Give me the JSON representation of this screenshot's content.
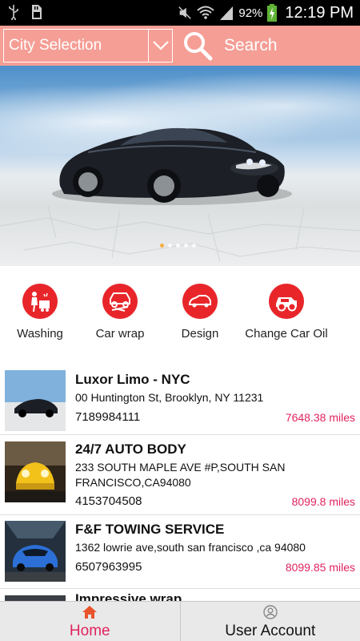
{
  "status_bar": {
    "battery": "92%",
    "time": "12:19 PM",
    "icons": [
      "usb-icon",
      "sd-card-icon",
      "mute-icon",
      "wifi-icon",
      "signal-icon",
      "battery-charging-icon"
    ]
  },
  "header": {
    "city_selection": "City Selection",
    "search_label": "Search"
  },
  "banner": {
    "image": "black sports car on salt flat",
    "slide_count": 5,
    "active_slide": 1
  },
  "categories": [
    {
      "label": "Washing",
      "icon": "washing-icon"
    },
    {
      "label": "Car wrap",
      "icon": "car-wrap-icon"
    },
    {
      "label": "Design",
      "icon": "design-icon"
    },
    {
      "label": "Change Car  Oil",
      "icon": "change-oil-icon"
    }
  ],
  "listings": [
    {
      "name": "Luxor Limo - NYC",
      "address": "00 Huntington St, Brooklyn, NY 11231",
      "phone": "7189984111",
      "distance": "7648.38 miles"
    },
    {
      "name": "24/7 AUTO BODY",
      "address": "233 SOUTH MAPLE AVE #P,SOUTH SAN FRANCISCO,CA94080",
      "phone": "4153704508",
      "distance": "8099.8 miles"
    },
    {
      "name": "F&F TOWING SERVICE",
      "address": "1362 lowrie ave,south san francisco ,ca 94080",
      "phone": "6507963995",
      "distance": "8099.85 miles"
    },
    {
      "name": "Impressive wrap",
      "address": "",
      "phone": "",
      "distance": ""
    }
  ],
  "bottom_nav": {
    "home": "Home",
    "account": "User Account"
  },
  "colors": {
    "header": "#f59e95",
    "accent_red": "#e8262a",
    "distance_pink": "#e0245e"
  }
}
